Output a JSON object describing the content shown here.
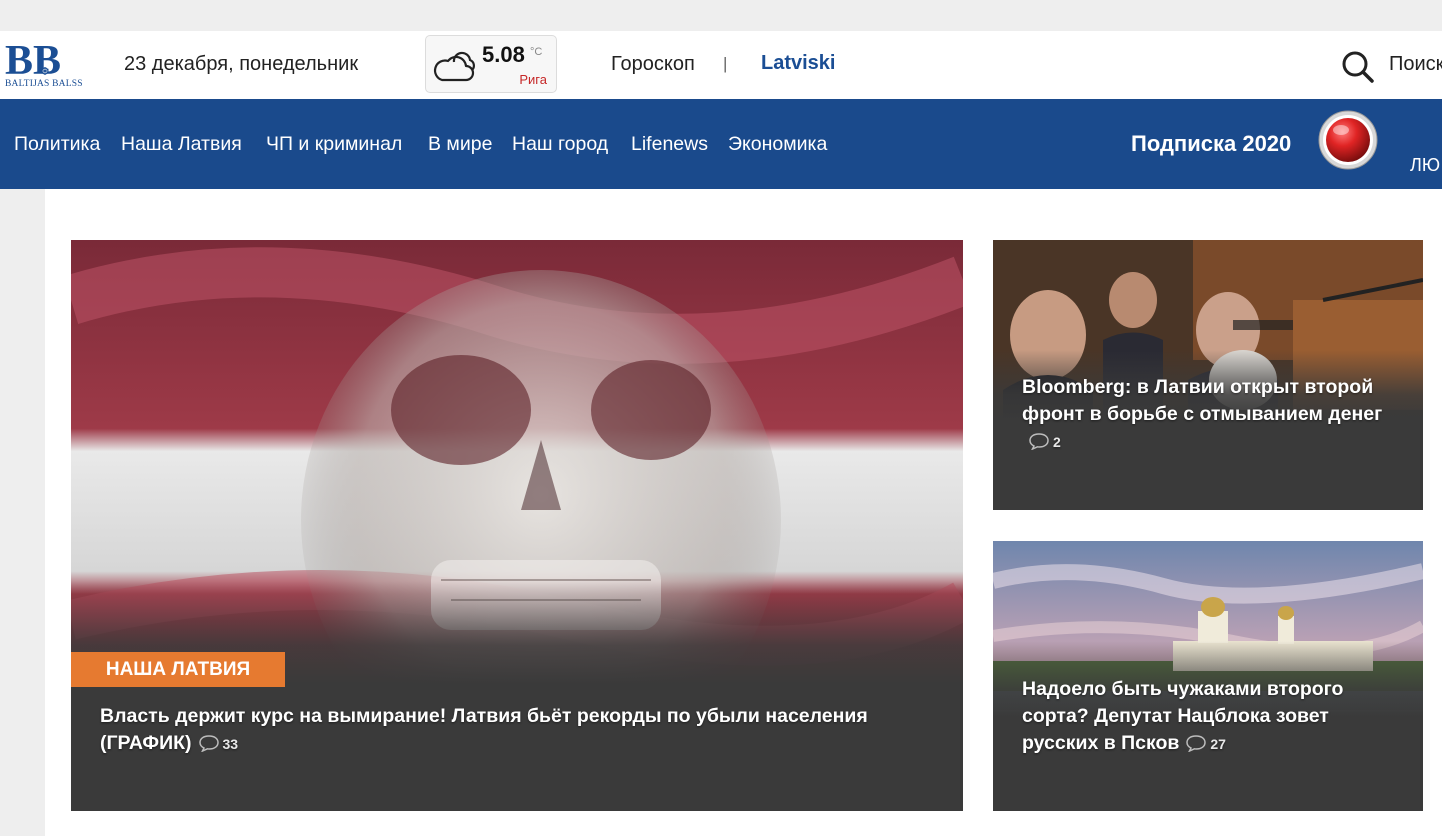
{
  "header": {
    "logo_letters": "BB",
    "logo_sub": "BALTIJAS BALSS",
    "date": "23 декабря, понедельник",
    "weather": {
      "temp": "5.08",
      "unit": "°C",
      "city": "Рига",
      "icon": "cloud-icon"
    },
    "horoscope": "Гороскоп",
    "separator": "|",
    "language_link": "Latviski",
    "search_label": "Поиск",
    "colors": {
      "brand_blue": "#1a4a8c",
      "accent_red": "#c62828"
    }
  },
  "nav": {
    "items": [
      "Политика",
      "Наша Латвия",
      "ЧП и криминал",
      "В мире",
      "Наш город",
      "Lifenews",
      "Экономика"
    ],
    "subscribe": "Подписка 2020",
    "cut_item": "ЛЮ"
  },
  "articles": {
    "main": {
      "category": "НАША ЛАТВИЯ",
      "title": "Власть держит курс на вымирание! Латвия бьёт рекорды по убыли населения (ГРАФИК)",
      "comments": "33",
      "category_color": "#e67a30"
    },
    "side1": {
      "title": "Bloomberg: в Латвии открыт второй фронт в борьбе с отмыванием денег",
      "comments": "2"
    },
    "side2": {
      "title": "Надоело быть чужаками второго сорта? Депутат Нацблока зовет русских в Псков",
      "comments": "27"
    }
  }
}
